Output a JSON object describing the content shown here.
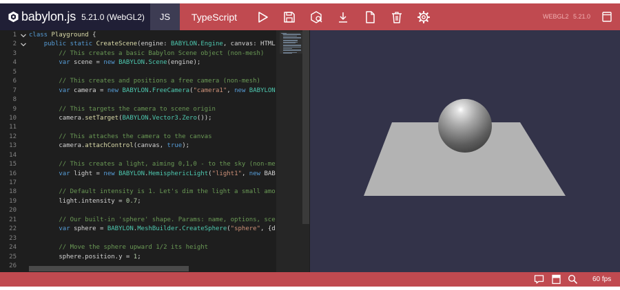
{
  "header": {
    "logo_text": "babylon.js",
    "version": "5.21.0 (WebGL2)",
    "tabs": [
      {
        "label": "JS",
        "active": true
      },
      {
        "label": "TypeScript",
        "active": false
      }
    ],
    "toolbar_icons": [
      "run-icon",
      "save-icon",
      "inspector-icon",
      "download-icon",
      "new-icon",
      "clear-icon",
      "settings-icon"
    ],
    "engine": "WEBGL2",
    "engine_version": "5.21.0",
    "fullscreen_icon": "fullscreen-icon"
  },
  "editor": {
    "line_numbers": [
      "1",
      "2",
      "3",
      "4",
      "5",
      "6",
      "7",
      "8",
      "9",
      "10",
      "11",
      "12",
      "13",
      "14",
      "15",
      "16",
      "17",
      "18",
      "19",
      "20",
      "21",
      "22",
      "23",
      "24",
      "25",
      "26"
    ],
    "lines": [
      "class Playground {",
      "    public static CreateScene(engine: BABYLON.Engine, canvas: HTML",
      "        // This creates a basic Babylon Scene object (non-mesh)",
      "        var scene = new BABYLON.Scene(engine);",
      "",
      "        // This creates and positions a free camera (non-mesh)",
      "        var camera = new BABYLON.FreeCamera(\"camera1\", new BABYLON",
      "",
      "        // This targets the camera to scene origin",
      "        camera.setTarget(BABYLON.Vector3.Zero());",
      "",
      "        // This attaches the camera to the canvas",
      "        camera.attachControl(canvas, true);",
      "",
      "        // This creates a light, aiming 0,1,0 - to the sky (non-me",
      "        var light = new BABYLON.HemisphericLight(\"light1\", new BAB",
      "",
      "        // Default intensity is 1. Let's dim the light a small amo",
      "        light.intensity = 0.7;",
      "",
      "        // Our built-in 'sphere' shape. Params: name, options, sce",
      "        var sphere = BABYLON.MeshBuilder.CreateSphere(\"sphere\", {d",
      "",
      "        // Move the sphere upward 1/2 its height",
      "        sphere.position.y = 1;",
      ""
    ]
  },
  "footer": {
    "icons": [
      "feedback-icon",
      "examples-icon",
      "search-icon"
    ],
    "fps": "60 fps"
  },
  "colors": {
    "accent": "#c04a50",
    "dark": "#201f36",
    "canvas_bg": "#333349"
  }
}
